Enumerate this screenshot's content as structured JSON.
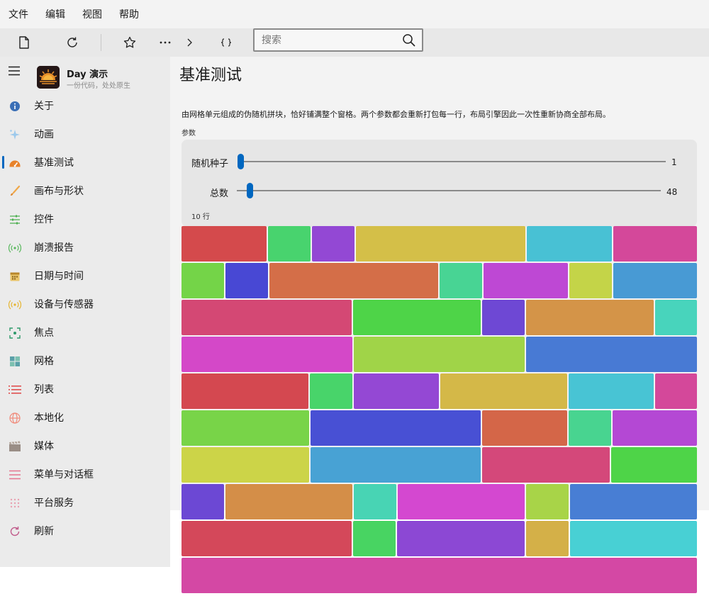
{
  "menubar": {
    "items": [
      "文件",
      "编辑",
      "视图",
      "帮助"
    ]
  },
  "toolbar": {
    "icons": [
      "new-document-icon",
      "refresh-icon",
      "star-icon",
      "more-icon",
      "chevron-right-icon",
      "braces-icon",
      "search-icon"
    ],
    "search_placeholder": "搜索",
    "search_value": ""
  },
  "app": {
    "title": "Day 演示",
    "subtitle": "一份代码，处处原生"
  },
  "sidebar": {
    "active": "基准测试",
    "items": [
      {
        "label": "关于",
        "icon": "info-icon",
        "color": "#3b6fb6"
      },
      {
        "label": "动画",
        "icon": "sparkle-icon",
        "color": "#7fb8e6"
      },
      {
        "label": "基准测试",
        "icon": "speedometer-icon",
        "color": "#e8822a"
      },
      {
        "label": "画布与形状",
        "icon": "brush-icon",
        "color": "#e9a040"
      },
      {
        "label": "控件",
        "icon": "sliders-icon",
        "color": "#4caf50"
      },
      {
        "label": "崩溃报告",
        "icon": "broadcast-icon",
        "color": "#58b85c"
      },
      {
        "label": "日期与时间",
        "icon": "calendar-icon",
        "color": "#c89a30"
      },
      {
        "label": "设备与传感器",
        "icon": "sensor-icon",
        "color": "#e6b530"
      },
      {
        "label": "焦点",
        "icon": "focus-icon",
        "color": "#2e9a6a"
      },
      {
        "label": "网格",
        "icon": "grid-icon",
        "color": "#5aa0a8"
      },
      {
        "label": "列表",
        "icon": "list-icon",
        "color": "#e05050"
      },
      {
        "label": "本地化",
        "icon": "globe-icon",
        "color": "#f08a7a"
      },
      {
        "label": "媒体",
        "icon": "clapperboard-icon",
        "color": "#9a8e86"
      },
      {
        "label": "菜单与对话框",
        "icon": "menu-lines-icon",
        "color": "#e57590"
      },
      {
        "label": "平台服务",
        "icon": "dots-grid-icon",
        "color": "#e8a0b0"
      },
      {
        "label": "刷新",
        "icon": "refresh-icon",
        "color": "#c05a8a"
      }
    ]
  },
  "page": {
    "title": "基准测试",
    "description": "由网格单元组成的伪随机拼块，恰好铺满整个窗格。两个参数都会重新打包每一行，布局引擎因此一次性重新协商全部布局。",
    "params_label": "参数",
    "params": [
      {
        "label": "随机种子",
        "value": "1",
        "fraction": 0.0
      },
      {
        "label": "总数",
        "value": "48",
        "fraction": 0.03
      }
    ],
    "rows_label": "10 行"
  },
  "mosaic": {
    "columns": 12,
    "rows": [
      [
        {
          "span": 2,
          "color": "#d44a4c"
        },
        {
          "span": 1,
          "color": "#48d36e"
        },
        {
          "span": 1,
          "color": "#9348d4"
        },
        {
          "span": 4,
          "color": "#d4bf48"
        },
        {
          "span": 2,
          "color": "#48c1d4"
        },
        {
          "span": 2,
          "color": "#d4489a"
        }
      ],
      [
        {
          "span": 1,
          "color": "#74d448"
        },
        {
          "span": 1,
          "color": "#4848d4"
        },
        {
          "span": 4,
          "color": "#d46e48"
        },
        {
          "span": 1,
          "color": "#48d494"
        },
        {
          "span": 2,
          "color": "#be48d4"
        },
        {
          "span": 1,
          "color": "#c4d448"
        },
        {
          "span": 2,
          "color": "#489ad4"
        }
      ],
      [
        {
          "span": 4,
          "color": "#d44874"
        },
        {
          "span": 3,
          "color": "#4ed448"
        },
        {
          "span": 1,
          "color": "#6e48d4"
        },
        {
          "span": 3,
          "color": "#d49448"
        },
        {
          "span": 1,
          "color": "#48d4bc"
        }
      ],
      [
        {
          "span": 4,
          "color": "#d448c8"
        },
        {
          "span": 4,
          "color": "#a0d448"
        },
        {
          "span": 4,
          "color": "#487ad4"
        }
      ],
      [
        {
          "span": 3,
          "color": "#d44850"
        },
        {
          "span": 1,
          "color": "#48d46a"
        },
        {
          "span": 2,
          "color": "#9448d4"
        },
        {
          "span": 3,
          "color": "#d4b848"
        },
        {
          "span": 2,
          "color": "#48c4d4"
        },
        {
          "span": 1,
          "color": "#d4489a"
        }
      ],
      [
        {
          "span": 3,
          "color": "#78d448"
        },
        {
          "span": 4,
          "color": "#4850d4"
        },
        {
          "span": 2,
          "color": "#d46648"
        },
        {
          "span": 1,
          "color": "#48d490"
        },
        {
          "span": 2,
          "color": "#b448d4"
        }
      ],
      [
        {
          "span": 3,
          "color": "#ccd448"
        },
        {
          "span": 4,
          "color": "#48a2d4"
        },
        {
          "span": 3,
          "color": "#d4487a"
        },
        {
          "span": 2,
          "color": "#4ed448"
        }
      ],
      [
        {
          "span": 1,
          "color": "#6c48d4"
        },
        {
          "span": 3,
          "color": "#d48e48"
        },
        {
          "span": 1,
          "color": "#48d4b4"
        },
        {
          "span": 3,
          "color": "#d448d0"
        },
        {
          "span": 1,
          "color": "#a8d448"
        },
        {
          "span": 3,
          "color": "#487ed4"
        }
      ],
      [
        {
          "span": 4,
          "color": "#d4485a"
        },
        {
          "span": 1,
          "color": "#48d462"
        },
        {
          "span": 3,
          "color": "#8c48d4"
        },
        {
          "span": 1,
          "color": "#d4b048"
        },
        {
          "span": 3,
          "color": "#48d0d4"
        }
      ],
      [
        {
          "span": 12,
          "color": "#d448a4"
        }
      ]
    ]
  }
}
